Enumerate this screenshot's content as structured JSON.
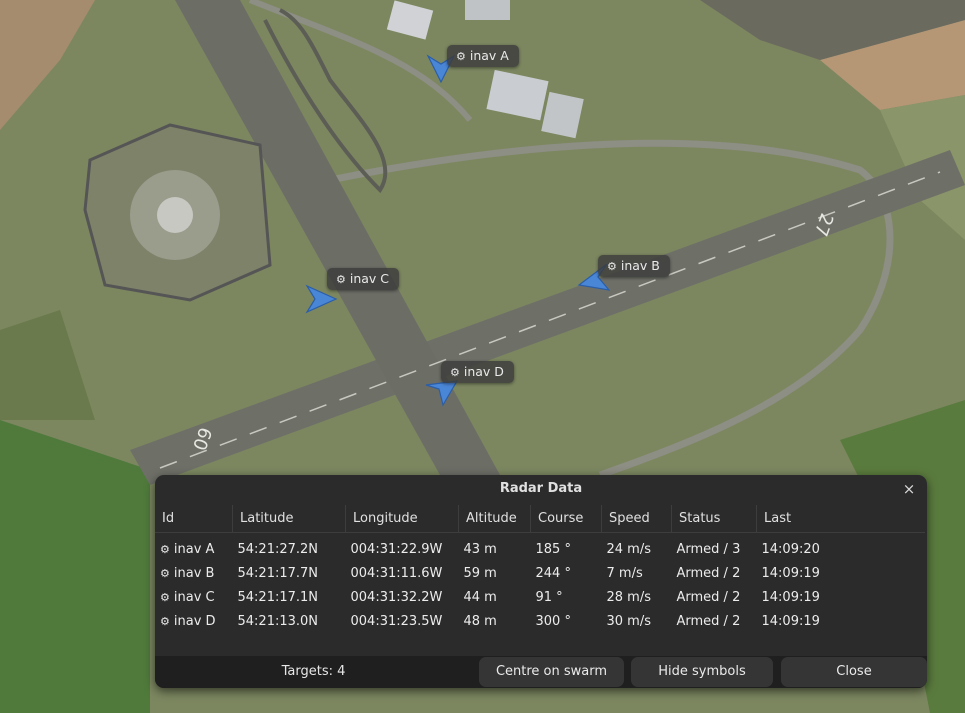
{
  "markers": [
    {
      "id": "a",
      "label": "inav A"
    },
    {
      "id": "b",
      "label": "inav B"
    },
    {
      "id": "c",
      "label": "inav C"
    },
    {
      "id": "d",
      "label": "inav D"
    }
  ],
  "map": {
    "runway_numbers": [
      "27",
      "09"
    ]
  },
  "dialog": {
    "title": "Radar Data",
    "close_symbol": "×",
    "columns": [
      "Id",
      "Latitude",
      "Longitude",
      "Altitude",
      "Course",
      "Speed",
      "Status",
      "Last"
    ],
    "rows": [
      {
        "id": "inav A",
        "lat": "54:21:27.2N",
        "lon": "004:31:22.9W",
        "alt": "43 m",
        "course": "185 °",
        "speed": "24 m/s",
        "status": "Armed / 3",
        "last": "14:09:20"
      },
      {
        "id": "inav B",
        "lat": "54:21:17.7N",
        "lon": "004:31:11.6W",
        "alt": "59 m",
        "course": "244 °",
        "speed": "7 m/s",
        "status": "Armed / 2",
        "last": "14:09:19"
      },
      {
        "id": "inav C",
        "lat": "54:21:17.1N",
        "lon": "004:31:32.2W",
        "alt": "44 m",
        "course": "91 °",
        "speed": "28 m/s",
        "status": "Armed / 2",
        "last": "14:09:19"
      },
      {
        "id": "inav D",
        "lat": "54:21:13.0N",
        "lon": "004:31:23.5W",
        "alt": "48 m",
        "course": "300 °",
        "speed": "30 m/s",
        "status": "Armed / 2",
        "last": "14:09:19"
      }
    ],
    "targets_label": "Targets: 4",
    "buttons": {
      "centre": "Centre on swarm",
      "hide": "Hide symbols",
      "close": "Close"
    }
  },
  "icons": {
    "gear": "⚙",
    "plane_color": "#4a86d6"
  }
}
